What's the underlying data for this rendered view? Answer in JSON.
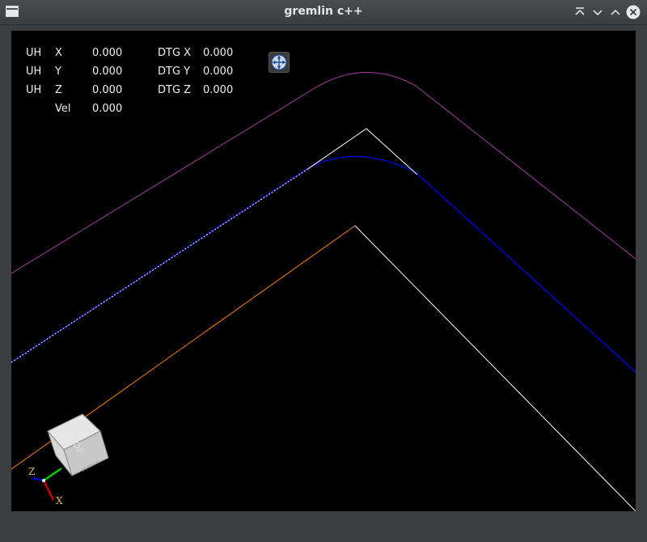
{
  "window": {
    "title": "gremlin c++"
  },
  "titlebar_buttons": [
    {
      "name": "keep-above-icon"
    },
    {
      "name": "minimize-icon"
    },
    {
      "name": "maximize-icon"
    },
    {
      "name": "close-icon"
    }
  ],
  "dro": {
    "rows": [
      {
        "prefix": "UH",
        "axis": "X",
        "value": "0.000",
        "dtg_label": "DTG X",
        "dtg_value": "0.000"
      },
      {
        "prefix": "UH",
        "axis": "Y",
        "value": "0.000",
        "dtg_label": "DTG Y",
        "dtg_value": "0.000"
      },
      {
        "prefix": "UH",
        "axis": "Z",
        "value": "0.000",
        "dtg_label": "DTG Z",
        "dtg_value": "0.000"
      }
    ],
    "vel_label": "Vel",
    "vel_value": "0.000"
  },
  "view_cube": {
    "face_label": "TOP",
    "side_label": "BOTTOM"
  },
  "axes": {
    "x_label": "X",
    "z_label": "Z",
    "x_color": "#cc0000",
    "y_color": "#00cc00",
    "z_color": "#0000cc",
    "label_color": "#e0c060"
  },
  "toolpath_colors": {
    "limit_outline": "#a040a0",
    "program_path": "#ffffff",
    "traverse_path": "#ff7f00",
    "offset_path": "#0000ff",
    "background": "#000000"
  }
}
